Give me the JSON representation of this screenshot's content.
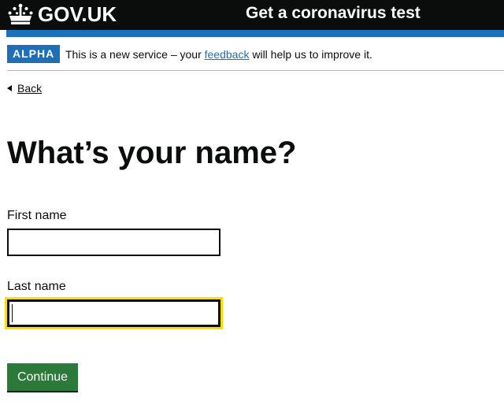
{
  "header": {
    "logo_text": "GOV.UK",
    "service_name": "Get a coronavirus test"
  },
  "phase_banner": {
    "tag": "ALPHA",
    "text_before": "This is a new service – your ",
    "link_text": "feedback",
    "text_after": " will help us to improve it."
  },
  "back_link": {
    "label": "Back"
  },
  "page": {
    "title": "What’s your name?"
  },
  "form": {
    "first_name": {
      "label": "First name",
      "value": ""
    },
    "last_name": {
      "label": "Last name",
      "value": ""
    },
    "continue_label": "Continue"
  },
  "colors": {
    "header_background": "#0b0c0c",
    "header_bar": "#1d70b8",
    "phase_tag": "#1d70b8",
    "link": "#1d70b8",
    "button": "#2b7a3a",
    "focus": "#ffdd00"
  },
  "icons": {
    "logo": "crown-icon",
    "back": "back-arrow-icon"
  }
}
